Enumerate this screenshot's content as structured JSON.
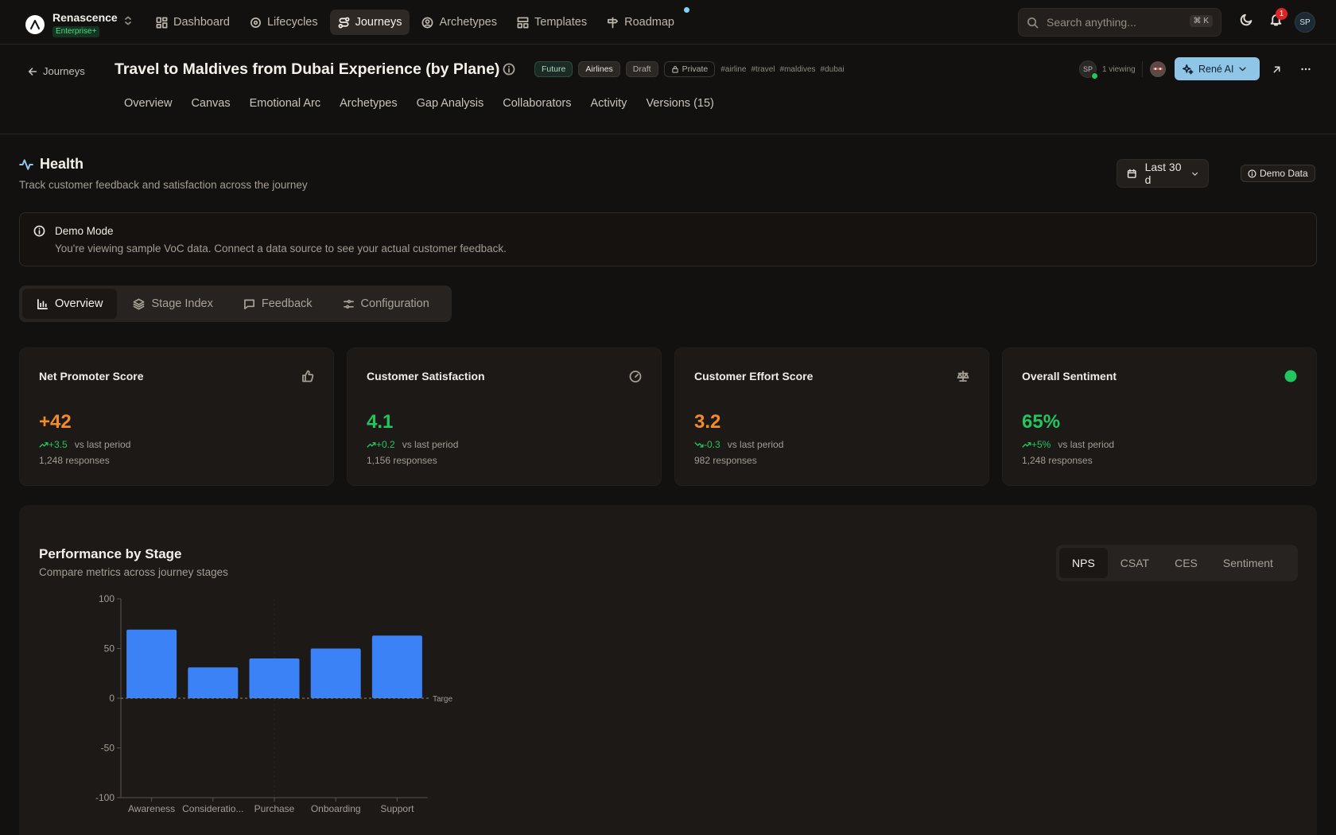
{
  "brand": {
    "name": "Renascence",
    "plan": "Enterprise+"
  },
  "nav": [
    {
      "label": "Dashboard",
      "icon": "grid-icon"
    },
    {
      "label": "Lifecycles",
      "icon": "cycle-icon"
    },
    {
      "label": "Journeys",
      "icon": "route-icon",
      "active": true
    },
    {
      "label": "Archetypes",
      "icon": "user-circle-icon"
    },
    {
      "label": "Templates",
      "icon": "layout-icon"
    },
    {
      "label": "Roadmap",
      "icon": "signpost-icon"
    }
  ],
  "search": {
    "placeholder": "Search anything...",
    "shortcut": "⌘ K"
  },
  "notifications": {
    "count": "1"
  },
  "user": {
    "initials": "SP"
  },
  "journey": {
    "back_label": "Journeys",
    "title": "Travel to Maldives from Dubai Experience (by Plane)",
    "tags": [
      "Future",
      "Airlines",
      "Draft",
      "Private"
    ],
    "hashtags": [
      "#airline",
      "#travel",
      "#maldives",
      "#dubai"
    ],
    "viewer_initials": "SP",
    "viewing": "1 viewing",
    "ai_button": "René AI",
    "tabs": [
      "Overview",
      "Canvas",
      "Emotional Arc",
      "Archetypes",
      "Gap Analysis",
      "Collaborators",
      "Activity",
      "Versions (15)"
    ]
  },
  "health": {
    "title": "Health",
    "subtitle": "Track customer feedback and satisfaction across the journey",
    "range": "Last 30 d",
    "demo_badge": "Demo Data",
    "alert_title": "Demo Mode",
    "alert_text": "You're viewing sample VoC data. Connect a data source to see your actual customer feedback.",
    "tabs": [
      "Overview",
      "Stage Index",
      "Feedback",
      "Configuration"
    ]
  },
  "kpis": [
    {
      "title": "Net Promoter Score",
      "value": "+42",
      "delta": "+3.5",
      "vs": "vs last period",
      "responses": "1,248 responses",
      "icon": "thumbs-up-icon",
      "color": "#f28c28",
      "trend": "up"
    },
    {
      "title": "Customer Satisfaction",
      "value": "4.1",
      "delta": "+0.2",
      "vs": "vs last period",
      "responses": "1,156 responses",
      "icon": "gauge-icon",
      "color": "#22c55e",
      "trend": "up"
    },
    {
      "title": "Customer Effort Score",
      "value": "3.2",
      "delta": "-0.3",
      "vs": "vs last period",
      "responses": "982 responses",
      "icon": "scale-icon",
      "color": "#f28c28",
      "trend": "down"
    },
    {
      "title": "Overall Sentiment",
      "value": "65%",
      "delta": "+5%",
      "vs": "vs last period",
      "responses": "1,248 responses",
      "icon": "status-dot-icon",
      "color": "#22c55e",
      "trend": "up"
    }
  ],
  "performance": {
    "title": "Performance by Stage",
    "subtitle": "Compare metrics across journey stages",
    "metric_tabs": [
      "NPS",
      "CSAT",
      "CES",
      "Sentiment"
    ]
  },
  "chart_data": {
    "type": "bar",
    "categories": [
      "Awareness",
      "Consideratio...",
      "Purchase",
      "Onboarding",
      "Support"
    ],
    "values": [
      69,
      31,
      40,
      50,
      63
    ],
    "ylim": [
      -100,
      100
    ],
    "yticks": [
      100,
      50,
      0,
      -50,
      -100
    ],
    "target_label": "Targe",
    "target_value": 0,
    "bar_color": "#3b82f6"
  }
}
